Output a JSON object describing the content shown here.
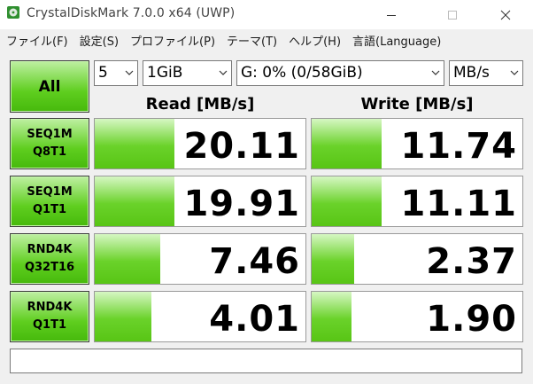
{
  "window": {
    "title": "CrystalDiskMark 7.0.0 x64 (UWP)"
  },
  "menu": [
    "ファイル(F)",
    "設定(S)",
    "プロファイル(P)",
    "テーマ(T)",
    "ヘルプ(H)",
    "言語(Language)"
  ],
  "controls": {
    "all_label": "All",
    "count": "5",
    "size": "1GiB",
    "drive": "G: 0% (0/58GiB)",
    "unit": "MB/s"
  },
  "headers": {
    "read": "Read [MB/s]",
    "write": "Write [MB/s]"
  },
  "tests": [
    {
      "line1": "SEQ1M",
      "line2": "Q8T1",
      "read": "20.11",
      "write": "11.74",
      "read_fill": 0.38,
      "write_fill": 0.33
    },
    {
      "line1": "SEQ1M",
      "line2": "Q1T1",
      "read": "19.91",
      "write": "11.11",
      "read_fill": 0.38,
      "write_fill": 0.33
    },
    {
      "line1": "RND4K",
      "line2": "Q32T16",
      "read": "7.46",
      "write": "2.37",
      "read_fill": 0.31,
      "write_fill": 0.2
    },
    {
      "line1": "RND4K",
      "line2": "Q1T1",
      "read": "4.01",
      "write": "1.90",
      "read_fill": 0.27,
      "write_fill": 0.19
    }
  ],
  "comment": ""
}
